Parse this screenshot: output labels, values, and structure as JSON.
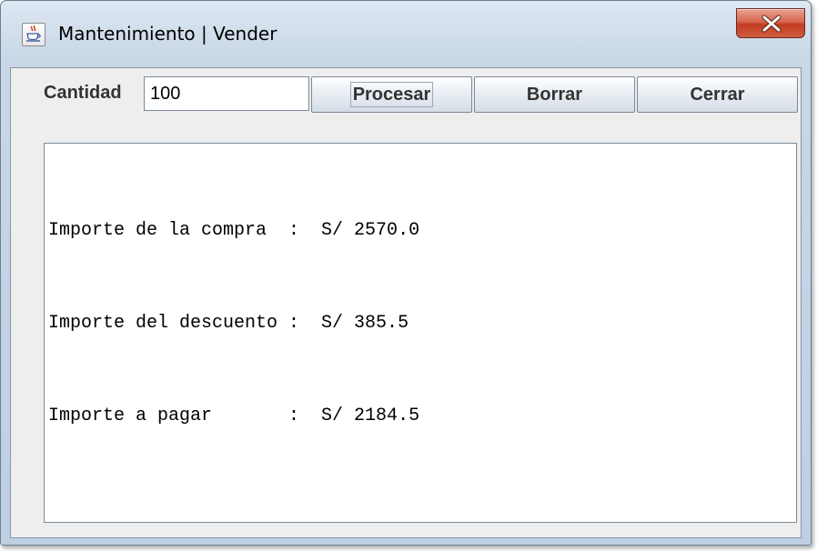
{
  "window": {
    "title": "Mantenimiento | Vender",
    "icon": "java-cup-icon",
    "close_icon": "close-x-icon"
  },
  "form": {
    "cantidad_label": "Cantidad",
    "cantidad_value": "100"
  },
  "buttons": {
    "procesar": "Procesar",
    "borrar": "Borrar",
    "cerrar": "Cerrar"
  },
  "output": {
    "lines": [
      "Importe de la compra  :  S/ 2570.0",
      "Importe del descuento :  S/ 385.5",
      "Importe a pagar       :  S/ 2184.5"
    ]
  },
  "colors": {
    "close_button": "#c23b22",
    "frame": "#c9d7e7",
    "client_bg": "#eeeeee"
  }
}
